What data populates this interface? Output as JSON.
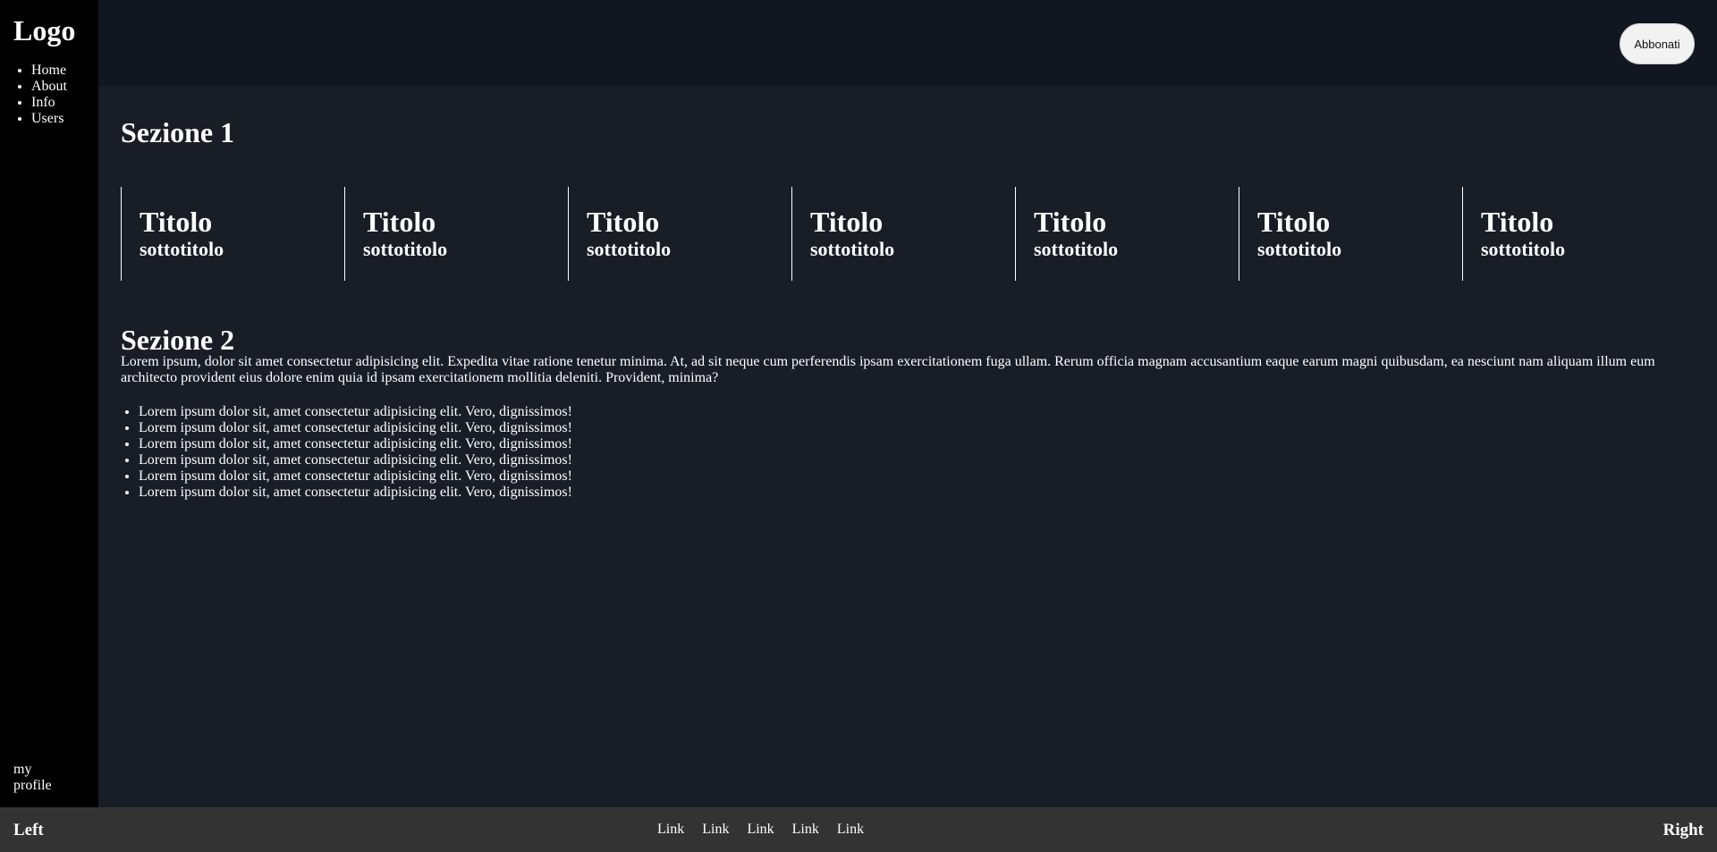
{
  "sidebar": {
    "logo": "Logo",
    "nav": [
      {
        "label": "Home"
      },
      {
        "label": "About"
      },
      {
        "label": "Info"
      },
      {
        "label": "Users"
      }
    ],
    "profile": "my profile"
  },
  "header": {
    "subscribe_label": "Abbonati"
  },
  "section1": {
    "title": "Sezione 1",
    "cards": [
      {
        "title": "Titolo",
        "subtitle": "sottotitolo"
      },
      {
        "title": "Titolo",
        "subtitle": "sottotitolo"
      },
      {
        "title": "Titolo",
        "subtitle": "sottotitolo"
      },
      {
        "title": "Titolo",
        "subtitle": "sottotitolo"
      },
      {
        "title": "Titolo",
        "subtitle": "sottotitolo"
      },
      {
        "title": "Titolo",
        "subtitle": "sottotitolo"
      },
      {
        "title": "Titolo",
        "subtitle": "sottotitolo"
      }
    ]
  },
  "section2": {
    "title": "Sezione 2",
    "paragraph": "Lorem ipsum, dolor sit amet consectetur adipisicing elit. Expedita vitae ratione tenetur minima. At, ad sit neque cum perferendis ipsam exercitationem fuga ullam. Rerum officia magnam accusantium eaque earum magni quibusdam, ea nesciunt nam aliquam illum eum architecto provident eius dolore enim quia id ipsam exercitationem mollitia deleniti. Provident, minima?",
    "items": [
      "Lorem ipsum dolor sit, amet consectetur adipisicing elit. Vero, dignissimos!",
      "Lorem ipsum dolor sit, amet consectetur adipisicing elit. Vero, dignissimos!",
      "Lorem ipsum dolor sit, amet consectetur adipisicing elit. Vero, dignissimos!",
      "Lorem ipsum dolor sit, amet consectetur adipisicing elit. Vero, dignissimos!",
      "Lorem ipsum dolor sit, amet consectetur adipisicing elit. Vero, dignissimos!",
      "Lorem ipsum dolor sit, amet consectetur adipisicing elit. Vero, dignissimos!"
    ]
  },
  "footer": {
    "left": "Left",
    "right": "Right",
    "links": [
      "Link",
      "Link",
      "Link",
      "Link",
      "Link"
    ]
  },
  "colors": {
    "sidebar_bg": "#000000",
    "header_bg": "#111620",
    "main_bg": "#181d26",
    "footer_bg": "#333333",
    "text": "#ffffff"
  }
}
